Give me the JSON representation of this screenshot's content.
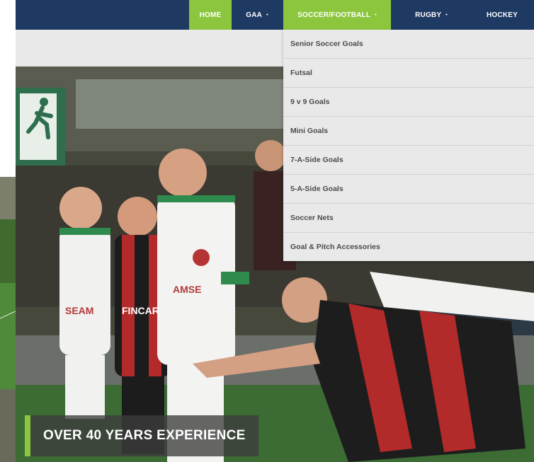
{
  "colors": {
    "nav_bg": "#1f3a62",
    "accent": "#8cc63f",
    "dropdown_bg": "#e9e9e9"
  },
  "nav": {
    "items": [
      {
        "label": "HOME",
        "has_caret": false,
        "active": true
      },
      {
        "label": "GAA",
        "has_caret": true,
        "active": false
      },
      {
        "label": "SOCCER/FOOTBALL",
        "has_caret": true,
        "active": true
      },
      {
        "label": "RUGBY",
        "has_caret": true,
        "active": false
      },
      {
        "label": "HOCKEY",
        "has_caret": false,
        "active": false
      }
    ],
    "caret_glyph": "•"
  },
  "dropdown": {
    "items": [
      "Senior Soccer Goals",
      "Futsal",
      "9 v 9 Goals",
      "Mini Goals",
      "7-A-Side Goals",
      "5-A-Side Goals",
      "Soccer Nets",
      "Goal & Pitch Accessories"
    ]
  },
  "hero": {
    "caption": "OVER 40 YEARS EXPERIENCE",
    "shirt_text_1": "SEAM",
    "shirt_text_2": "FINCAR",
    "shirt_text_3": "AMSE"
  }
}
